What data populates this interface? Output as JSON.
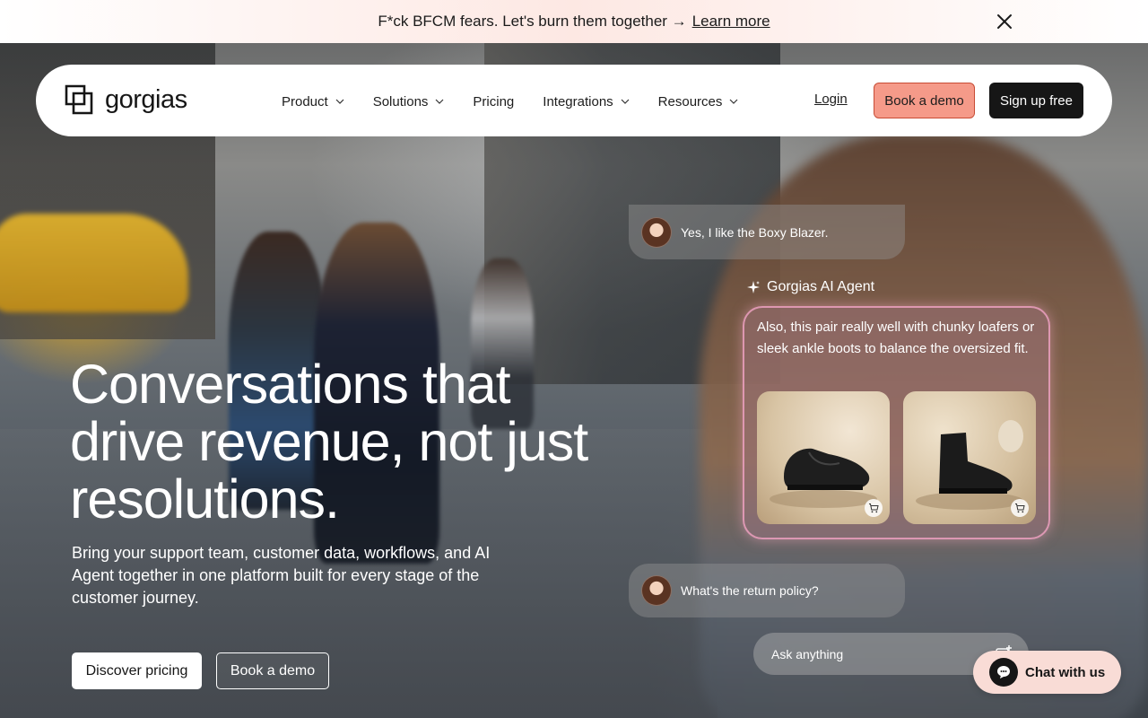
{
  "banner": {
    "text": "F*ck BFCM fears. Let's burn them together →",
    "cta": "Learn more",
    "close_icon": "close-icon"
  },
  "nav": {
    "logo_text": "gorgias",
    "menu": [
      {
        "label": "Product",
        "has_dropdown": true
      },
      {
        "label": "Solutions",
        "has_dropdown": true
      },
      {
        "label": "Pricing",
        "has_dropdown": false
      },
      {
        "label": "Integrations",
        "has_dropdown": true
      },
      {
        "label": "Resources",
        "has_dropdown": true
      }
    ],
    "login": "Login",
    "book_demo": "Book a demo",
    "signup": "Sign up free"
  },
  "hero": {
    "title": "Conversations that drive revenue, not just resolutions.",
    "subtitle": "Bring your support team, customer data, workflows, and AI Agent together in one platform built for every stage of the customer journey.",
    "primary_cta": "Discover pricing",
    "secondary_cta": "Book a demo"
  },
  "chat_demo": {
    "customer_msg_1": "Yes, I like the Boxy Blazer.",
    "agent_label": "Gorgias AI Agent",
    "agent_msg": "Also, this pair really well with chunky loafers or sleek ankle boots to balance the oversized fit.",
    "products": [
      {
        "name": "chunky-loafers",
        "icon": "cart-icon"
      },
      {
        "name": "ankle-boots",
        "icon": "cart-icon"
      }
    ],
    "customer_msg_2": "What's the return policy?",
    "ask_placeholder": "Ask anything"
  },
  "chat_widget": {
    "label": "Chat with us"
  },
  "colors": {
    "brand_coral": "#f59a89",
    "dark": "#161616",
    "agent_border": "#eca0be",
    "widget_bg": "#f9dcd6"
  }
}
